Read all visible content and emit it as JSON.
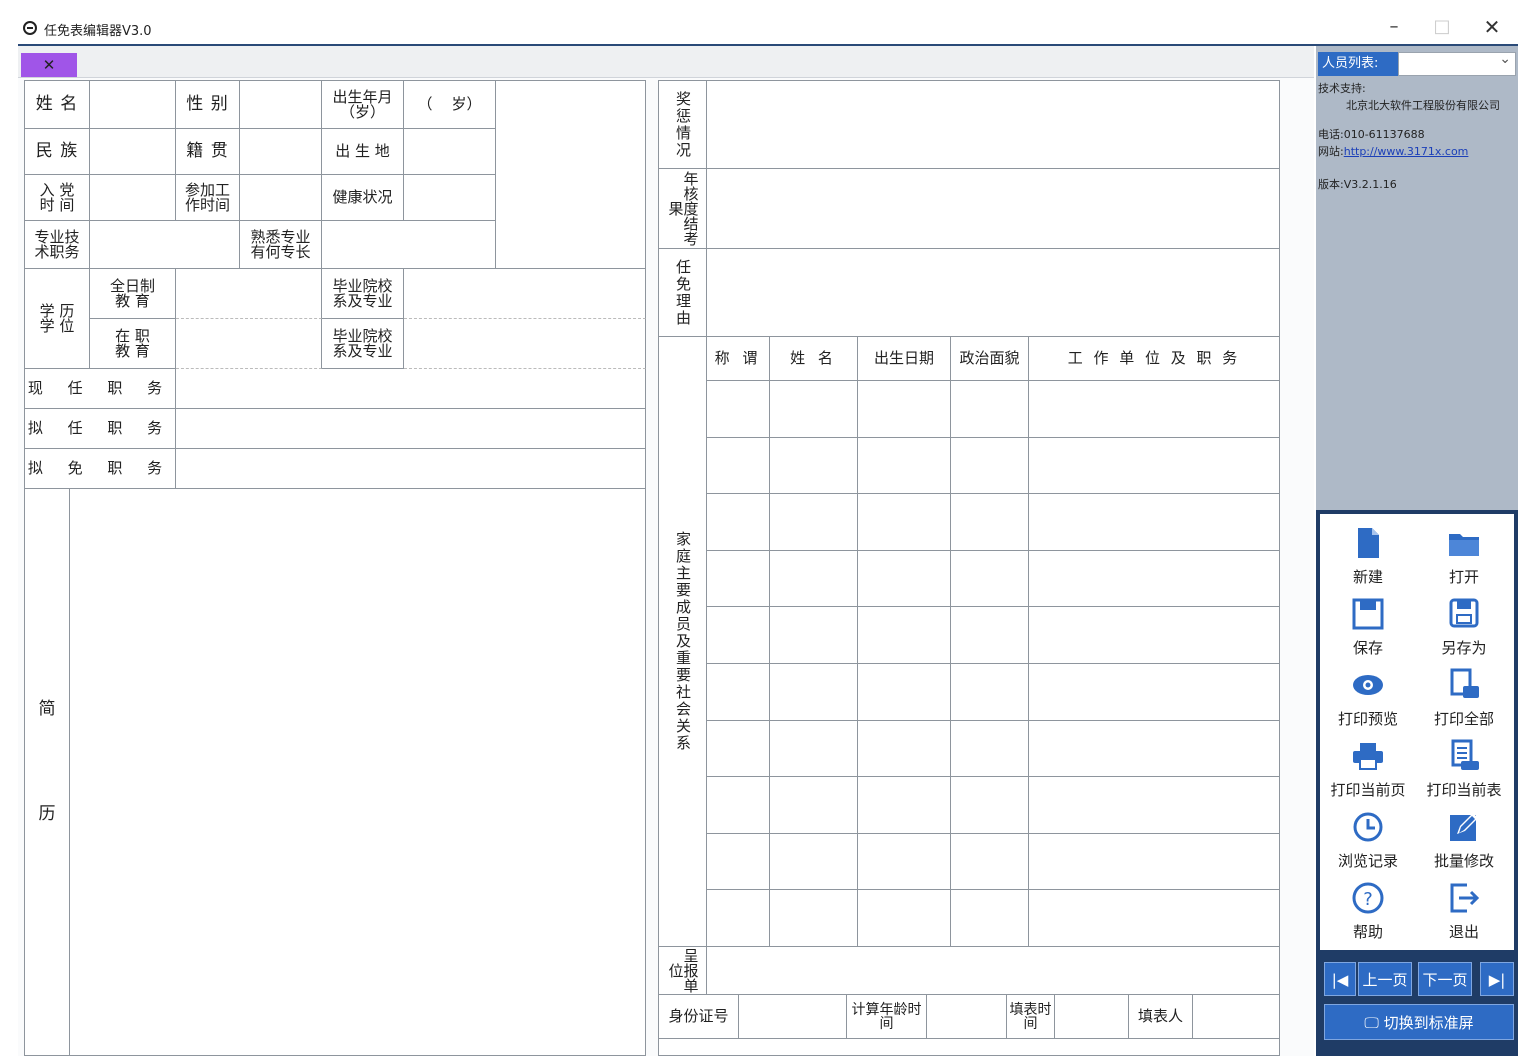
{
  "window": {
    "title": "任免表编辑器V3.0",
    "minimize": "–",
    "maximize": "□",
    "close": "✕"
  },
  "tab": {
    "close_label": "✕"
  },
  "form_left": {
    "name_label": "姓 名",
    "gender_label": "性 别",
    "birth_label": "出生年月\n（岁）",
    "age_value": "（    岁）",
    "ethnicity_label": "民 族",
    "native_label": "籍 贯",
    "birthplace_label": "出 生 地",
    "party_label": "入 党\n时 间",
    "work_start_label": "参加工\n作时间",
    "health_label": "健康状况",
    "tech_title_label": "专业技\n术职务",
    "specialty_label": "熟悉专业\n有何专长",
    "education_label": "学 历\n学 位",
    "fulltime_label": "全日制\n教 育",
    "school_label_1": "毕业院校\n系及专业",
    "inservice_label": "在 职\n教 育",
    "school_label_2": "毕业院校\n系及专业",
    "current_post_label": "现 任 职 务",
    "proposed_post_label": "拟 任 职 务",
    "removed_post_label": "拟 免 职 务",
    "resume_label_1": "简",
    "resume_label_2": "历"
  },
  "form_right": {
    "awards_label": "奖惩情况",
    "annual_label": "年核度结考果",
    "reason_label": "任免理由",
    "family_label": "家庭主要成员及重要社会关系",
    "col_relation": "称 谓",
    "col_name": "姓 名",
    "col_birth": "出生日期",
    "col_politics": "政治面貌",
    "col_work": "工 作 单 位 及 职 务",
    "report_label": "呈报单位",
    "id_label": "身份证号",
    "calc_age_label": "计算年龄时 间",
    "fill_time_label": "填表时间",
    "filler_label": "填表人"
  },
  "side": {
    "person_list_label": "人员列表:",
    "support_title": "技术支持:",
    "company": "北京北大软件工程股份有限公司",
    "phone": "电话:010-61137688",
    "website_label": "网站:",
    "website": "http://www.3171x.com",
    "version": "版本:V3.2.1.16"
  },
  "tools": [
    {
      "label": "新建",
      "icon": "new-file-icon"
    },
    {
      "label": "打开",
      "icon": "folder-open-icon"
    },
    {
      "label": "保存",
      "icon": "save-icon"
    },
    {
      "label": "另存为",
      "icon": "save-as-icon"
    },
    {
      "label": "打印预览",
      "icon": "eye-icon"
    },
    {
      "label": "打印全部",
      "icon": "print-all-icon"
    },
    {
      "label": "打印当前页",
      "icon": "printer-icon"
    },
    {
      "label": "打印当前表",
      "icon": "print-table-icon"
    },
    {
      "label": "浏览记录",
      "icon": "history-icon"
    },
    {
      "label": "批量修改",
      "icon": "edit-icon"
    },
    {
      "label": "帮助",
      "icon": "help-icon"
    },
    {
      "label": "退出",
      "icon": "exit-icon"
    }
  ],
  "pager": {
    "first": "|◀",
    "prev": "上一页",
    "next": "下一页",
    "last": "▶|"
  },
  "switch_label": "切换到标准屏",
  "colors": {
    "accent": "#2e6bc4",
    "panel": "#aeb9c7",
    "dark": "#1f3c66",
    "tab": "#a055e8"
  }
}
